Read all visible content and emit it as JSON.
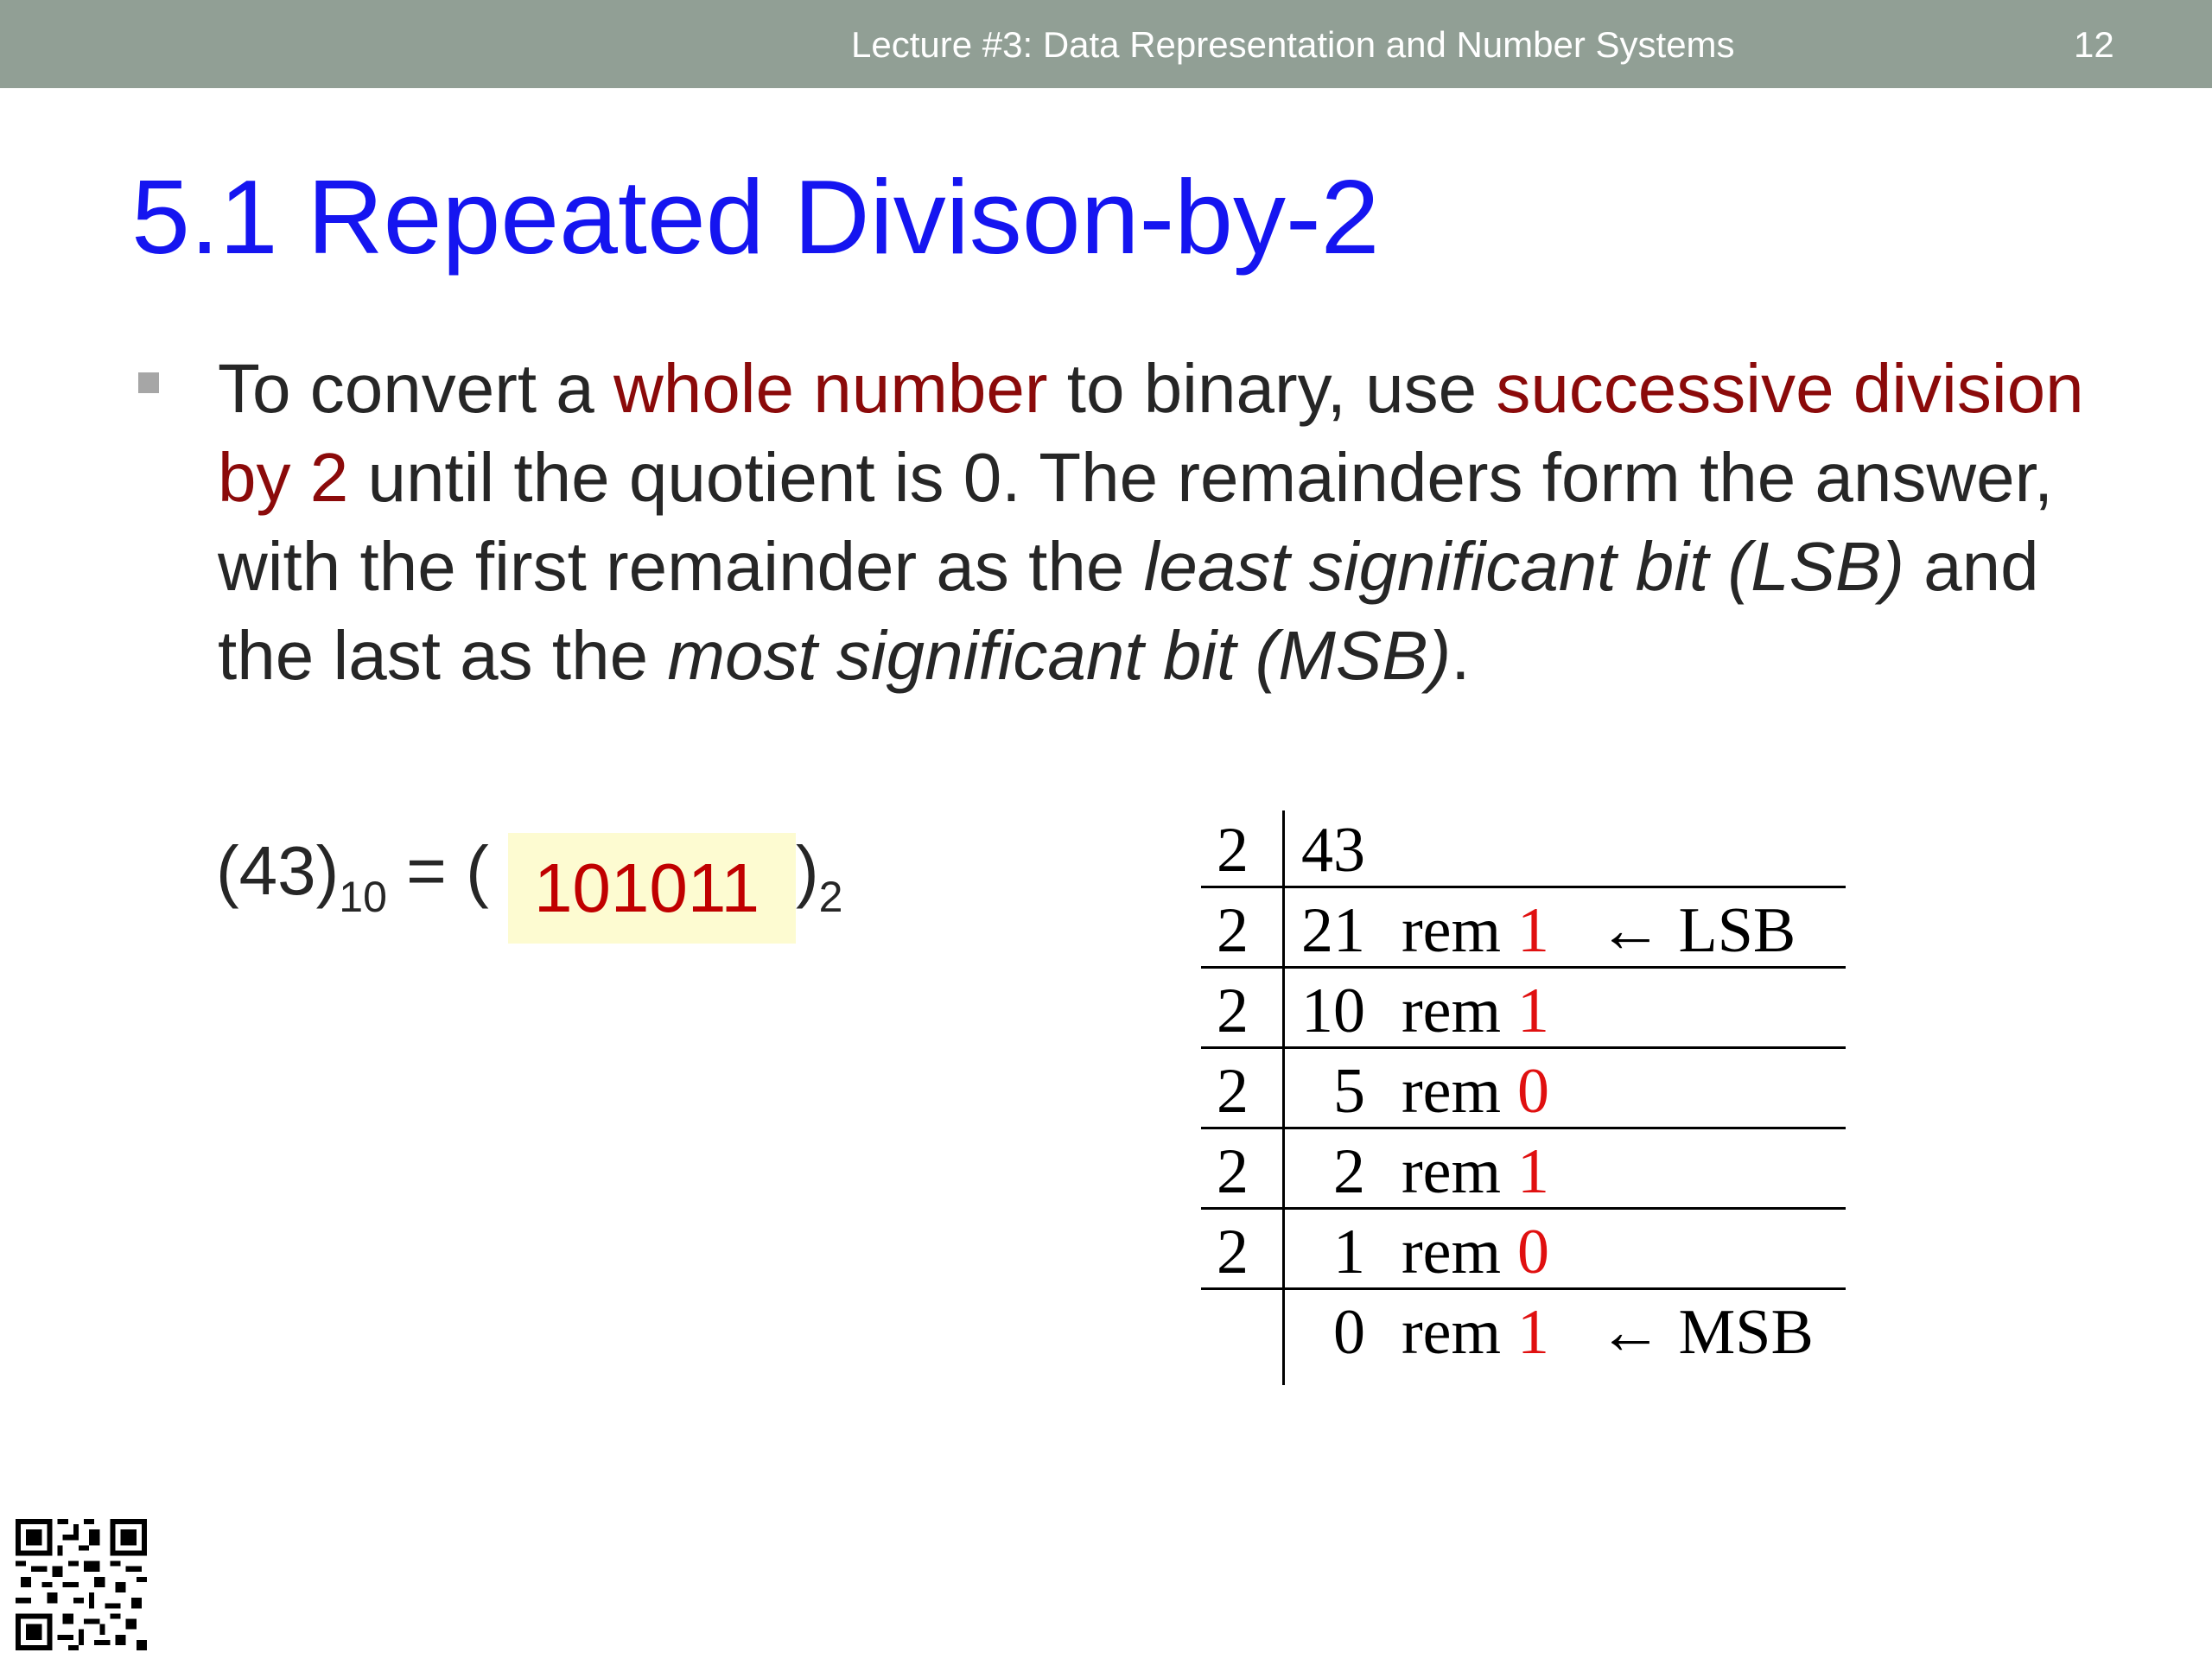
{
  "header": {
    "lecture_title": "Lecture #3: Data Representation and Number Systems",
    "page_number": "12"
  },
  "slide": {
    "title": "5.1 Repeated Divison-by-2",
    "bullet": {
      "t1": "To convert a ",
      "h1": "whole number",
      "t2": " to binary, use ",
      "h2": "successive division by 2",
      "t3": " until the quotient is 0.  The remainders form the answer, with the first remainder as the ",
      "i1": "least significant bit (LSB)",
      "t4": " and the last as the ",
      "i2": "most significant bit (MSB)",
      "t5": "."
    },
    "equation": {
      "lhs_value": "(43)",
      "lhs_base": "10",
      "equals_open": " = ( ",
      "answer": "101011",
      "close_paren": ")",
      "rhs_base": "2"
    },
    "division_table": {
      "rows": [
        {
          "divisor": "2",
          "quotient": "43",
          "rem_label": "",
          "bit": "",
          "note": ""
        },
        {
          "divisor": "2",
          "quotient": "21",
          "rem_label": "rem",
          "bit": "1",
          "note": "← LSB"
        },
        {
          "divisor": "2",
          "quotient": "10",
          "rem_label": "rem",
          "bit": "1",
          "note": ""
        },
        {
          "divisor": "2",
          "quotient": "5",
          "rem_label": "rem",
          "bit": "0",
          "note": ""
        },
        {
          "divisor": "2",
          "quotient": "2",
          "rem_label": "rem",
          "bit": "1",
          "note": ""
        },
        {
          "divisor": "2",
          "quotient": "1",
          "rem_label": "rem",
          "bit": "0",
          "note": ""
        },
        {
          "divisor": "",
          "quotient": "0",
          "rem_label": "rem",
          "bit": "1",
          "note": "← MSB"
        }
      ]
    }
  },
  "icons": {
    "qr": "qr-code-icon"
  },
  "colors": {
    "header_bg": "#919f95",
    "title": "#1515f0",
    "highlight_text": "#8b0a0a",
    "remainder_bit": "#e01010",
    "answer_bg": "#fdfbd1"
  }
}
